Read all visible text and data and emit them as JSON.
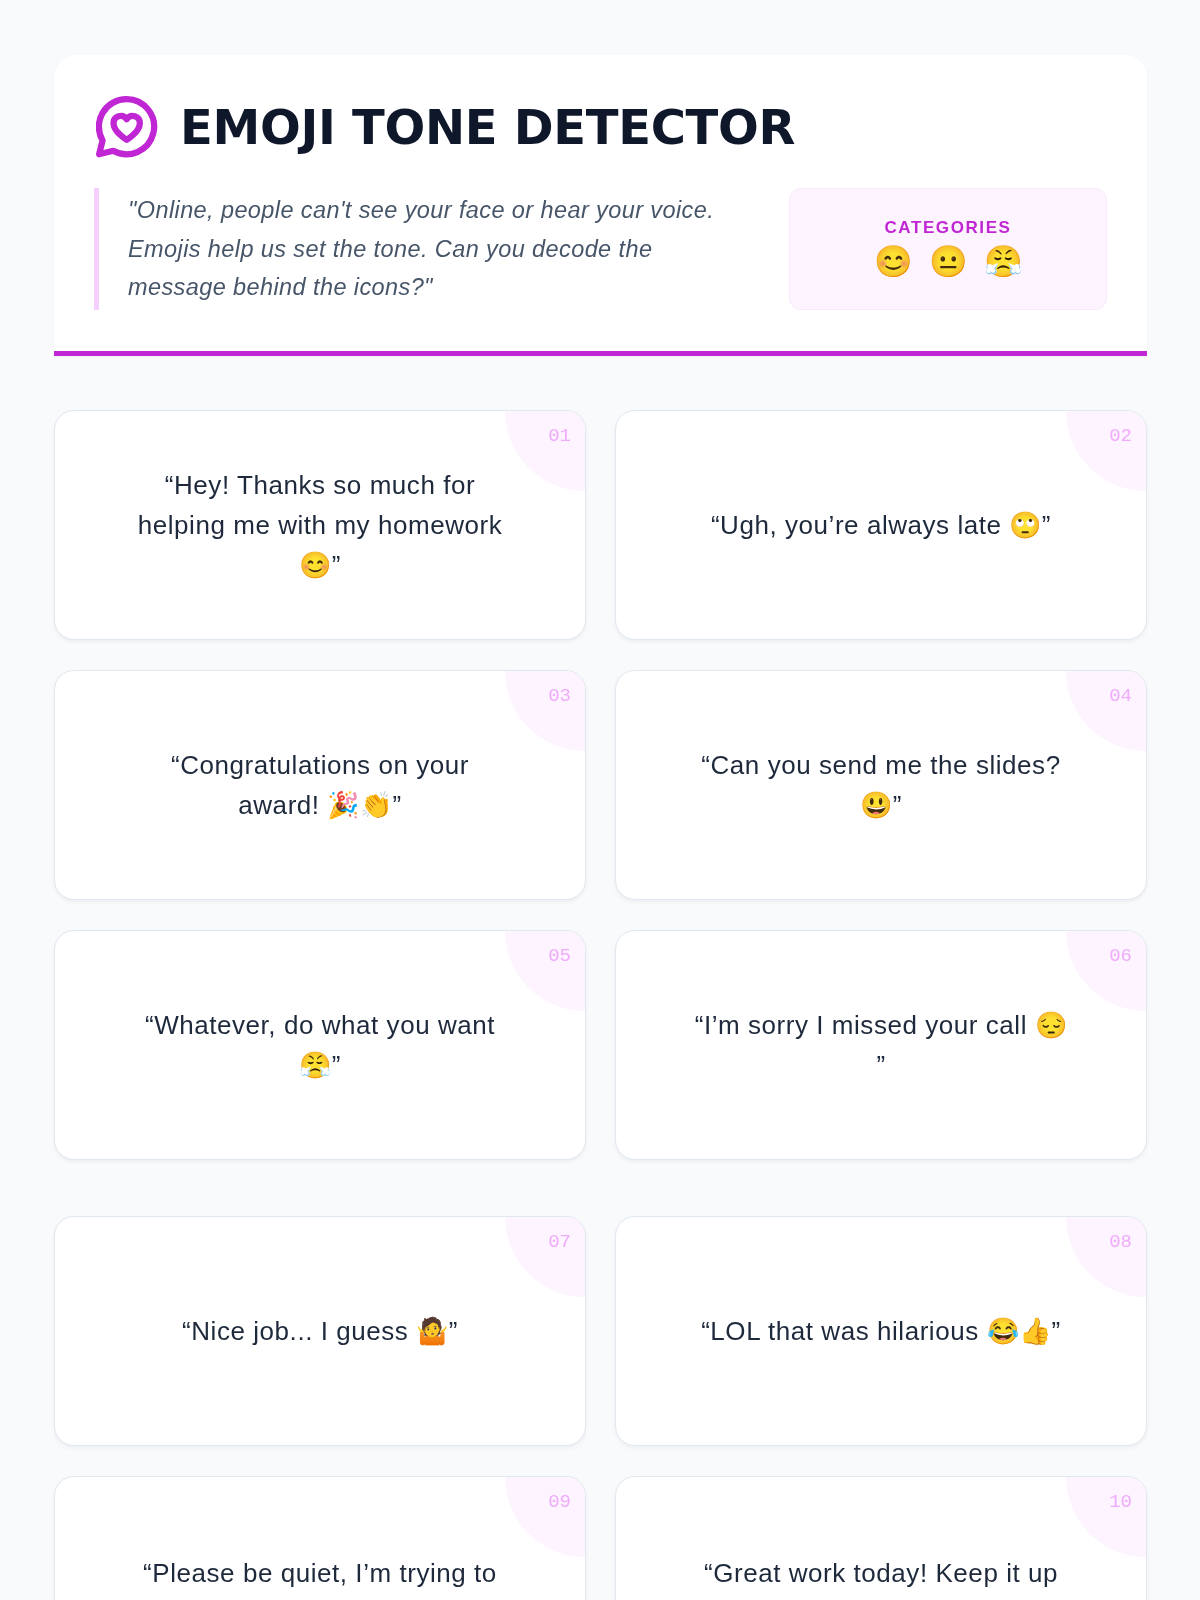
{
  "header": {
    "title": "EMOJI TONE DETECTOR",
    "quote": "\"Online, people can't see your face or hear your voice. Emojis help us set the tone. Can you decode the message behind the icons?\"",
    "categories": {
      "label": "CATEGORIES",
      "emojis": [
        "😊",
        "😐",
        "😤"
      ]
    }
  },
  "card_groups": [
    {
      "cards": [
        {
          "number": "01",
          "message": "“Hey! Thanks so much for helping me with my homework 😊”"
        },
        {
          "number": "02",
          "message": "“Ugh, you’re always late 🙄”"
        },
        {
          "number": "03",
          "message": "“Congratulations on your award! 🎉👏”"
        },
        {
          "number": "04",
          "message": "“Can you send me the slides? 😃”"
        },
        {
          "number": "05",
          "message": "“Whatever, do what you want 😤”"
        },
        {
          "number": "06",
          "message": "“I’m sorry I missed your call 😔\n”"
        }
      ]
    },
    {
      "cards": [
        {
          "number": "07",
          "message": "“Nice job... I guess 🤷”"
        },
        {
          "number": "08",
          "message": "“LOL that was hilarious 😂👍”"
        },
        {
          "number": "09",
          "message": "“Please be quiet, I’m trying to"
        },
        {
          "number": "10",
          "message": "“Great work today! Keep it up"
        }
      ]
    }
  ]
}
